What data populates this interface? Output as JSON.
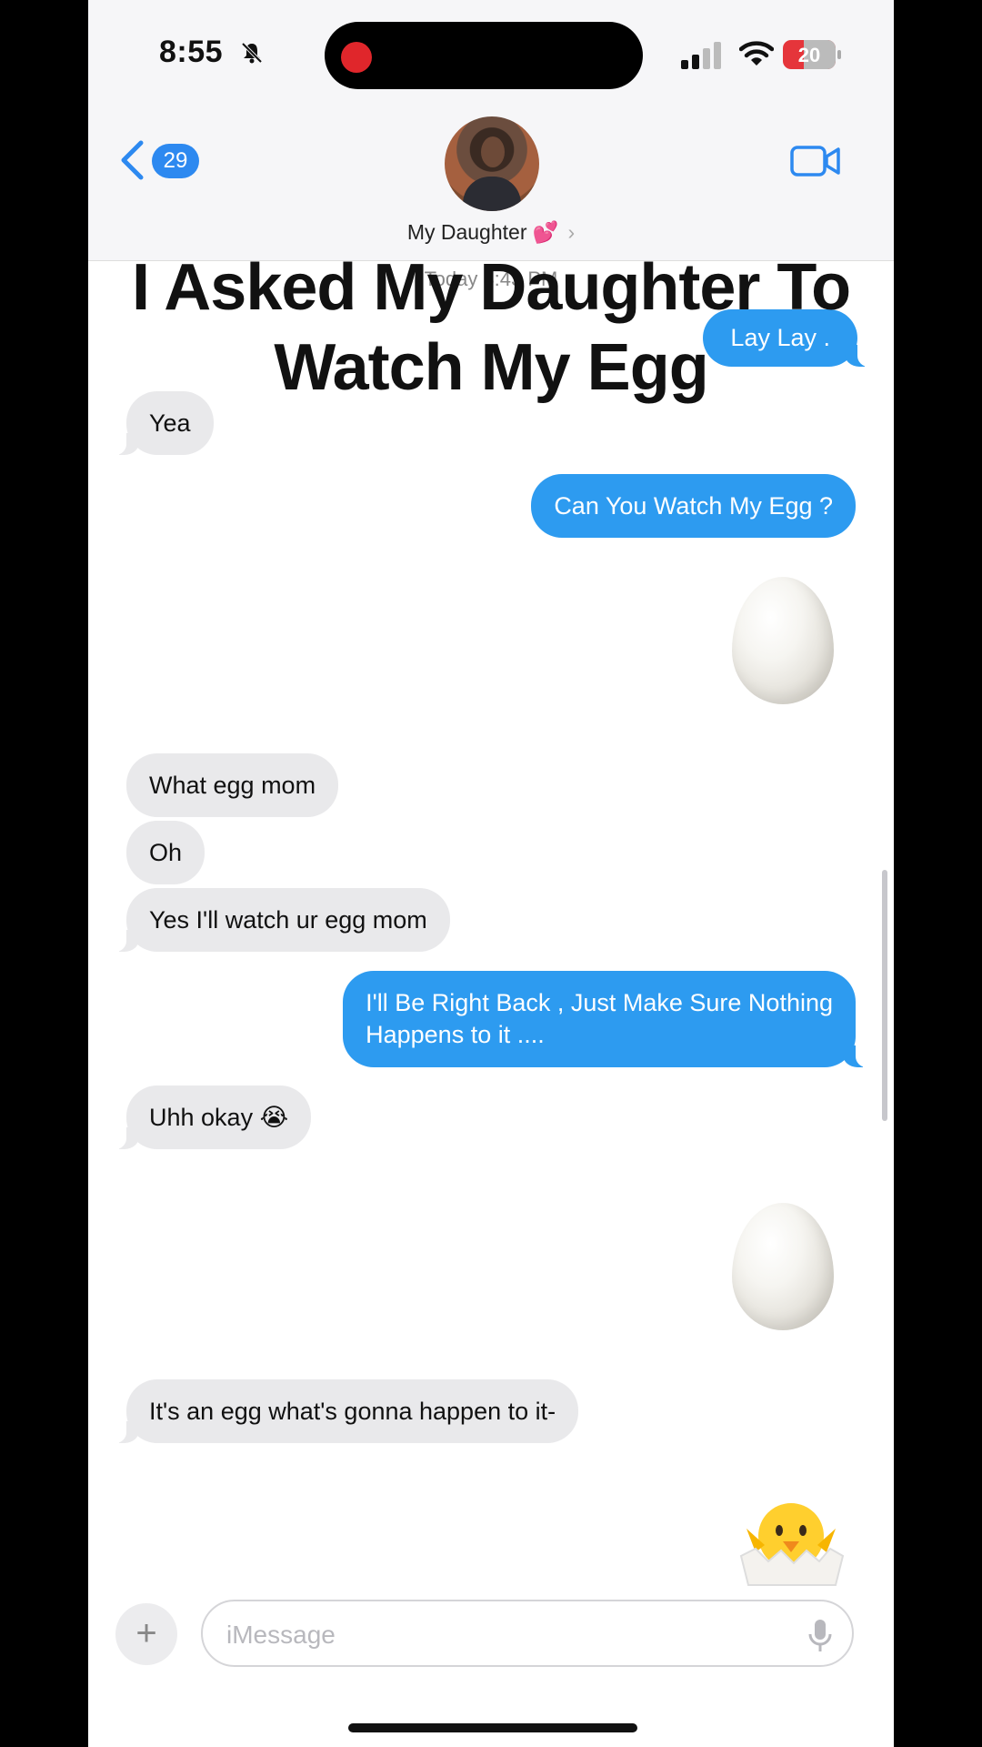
{
  "status_bar": {
    "time": "8:55",
    "battery": "20"
  },
  "header": {
    "back_badge": "29",
    "contact_name": "My Daughter 💕",
    "chevron": "›"
  },
  "overlay": {
    "title_line1": "I Asked My Daughter To",
    "title_line2": "Watch My Egg"
  },
  "conversation": {
    "timestamp": "Today 3:43 PM",
    "messages": [
      {
        "side": "out",
        "text": "Lay Lay ."
      },
      {
        "side": "in",
        "text": "Yea"
      },
      {
        "side": "out",
        "text": "Can You Watch My Egg ?"
      },
      {
        "side": "out",
        "emoji": "egg"
      },
      {
        "side": "in",
        "text": "What egg mom"
      },
      {
        "side": "in",
        "text": "Oh"
      },
      {
        "side": "in",
        "text": "Yes I'll watch ur egg mom"
      },
      {
        "side": "out",
        "text_line1": "I'll Be Right Back , Just Make Sure Nothing",
        "text_line2": "Happens to it ...."
      },
      {
        "side": "in",
        "text": "Uhh okay 😭"
      },
      {
        "side": "out",
        "emoji": "egg"
      },
      {
        "side": "in",
        "text": "It's an egg what's gonna happen to it-"
      },
      {
        "side": "out",
        "emoji": "hatching-chick"
      }
    ]
  },
  "input_bar": {
    "plus": "+",
    "placeholder": "iMessage"
  },
  "colors": {
    "outgoing": "#2d9bf0",
    "incoming": "#e9e9eb",
    "accent": "#2d89f0"
  }
}
